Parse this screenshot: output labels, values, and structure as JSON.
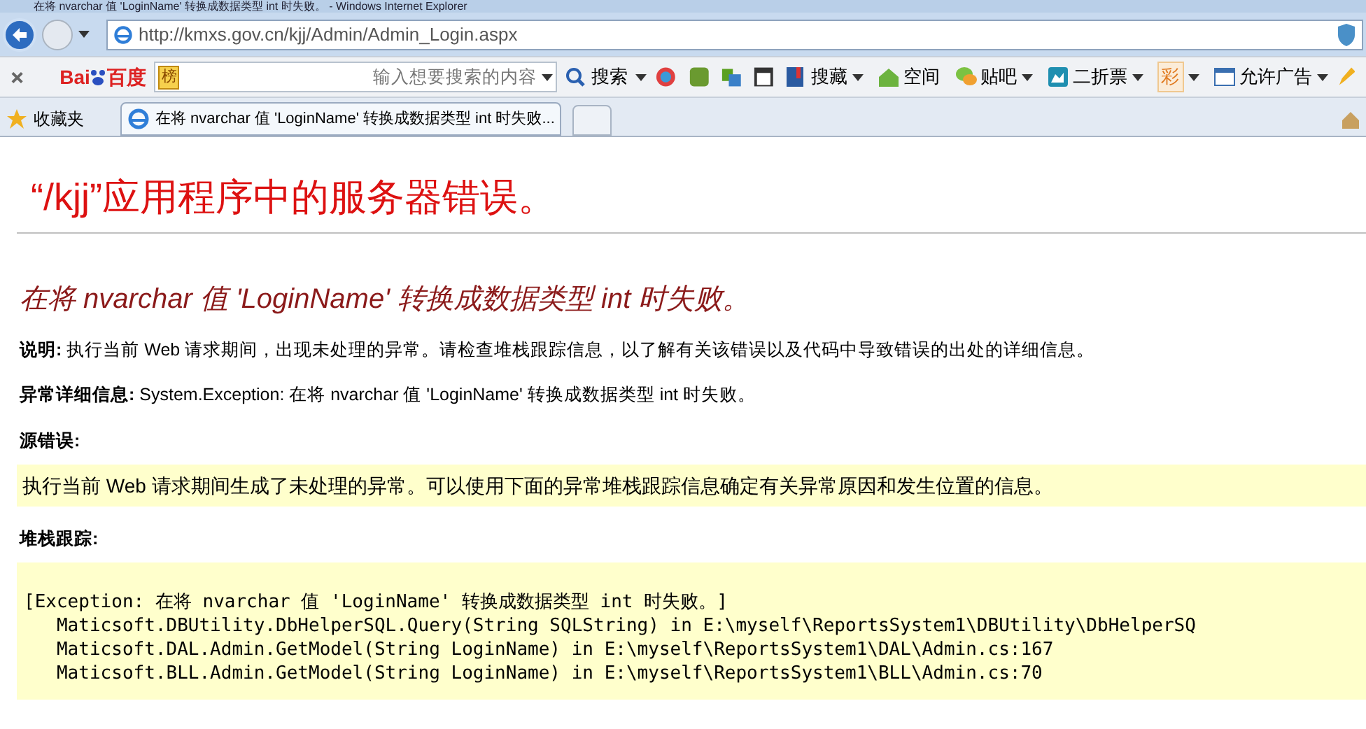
{
  "window": {
    "title": "在将 nvarchar 值 'LoginName' 转换成数据类型 int 时失败。 - Windows Internet Explorer"
  },
  "address_bar": {
    "url": "http://kmxs.gov.cn/kjj/Admin/Admin_Login.aspx"
  },
  "toolbar": {
    "logo_latin": "Bai",
    "logo_cjk": "百度",
    "rank_badge": "榜",
    "search": {
      "placeholder": "输入想要搜索的内容"
    },
    "search_button": "搜索",
    "items": [
      {
        "label": "搜藏",
        "dropdown": true
      },
      {
        "label": "空间",
        "dropdown": false
      },
      {
        "label": "贴吧",
        "dropdown": true
      },
      {
        "label": "二折票",
        "dropdown": true
      },
      {
        "label": "彩",
        "dropdown": true
      },
      {
        "label": "允许广告",
        "dropdown": true
      }
    ]
  },
  "favorites": {
    "label": "收藏夹"
  },
  "tabs": [
    {
      "label": "在将 nvarchar 值 'LoginName' 转换成数据类型 int 时失败...",
      "selected": true
    }
  ],
  "page": {
    "heading": "“/kjj”应用程序中的服务器错误。",
    "error_title": "在将 nvarchar 值 'LoginName' 转换成数据类型 int 时失败。",
    "fields": [
      {
        "label": "说明:",
        "text": "执行当前 Web 请求期间，出现未处理的异常。请检查堆栈跟踪信息，以了解有关该错误以及代码中导致错误的出处的详细信息。"
      },
      {
        "label": "异常详细信息:",
        "text": "System.Exception: 在将 nvarchar 值 'LoginName' 转换成数据类型 int 时失败。"
      }
    ],
    "source_label": "源错误:",
    "source_text": "执行当前 Web 请求期间生成了未处理的异常。可以使用下面的异常堆栈跟踪信息确定有关异常原因和发生位置的信息。",
    "stack_label": "堆栈跟踪:",
    "stack_lines": [
      "[Exception: 在将 nvarchar 值 'LoginName' 转换成数据类型 int 时失败。]",
      "   Maticsoft.DBUtility.DbHelperSQL.Query(String SQLString) in E:\\myself\\ReportsSystem1\\DBUtility\\DbHelperSQ",
      "   Maticsoft.DAL.Admin.GetModel(String LoginName) in E:\\myself\\ReportsSystem1\\DAL\\Admin.cs:167",
      "   Maticsoft.BLL.Admin.GetModel(String LoginName) in E:\\myself\\ReportsSystem1\\BLL\\Admin.cs:70"
    ]
  }
}
